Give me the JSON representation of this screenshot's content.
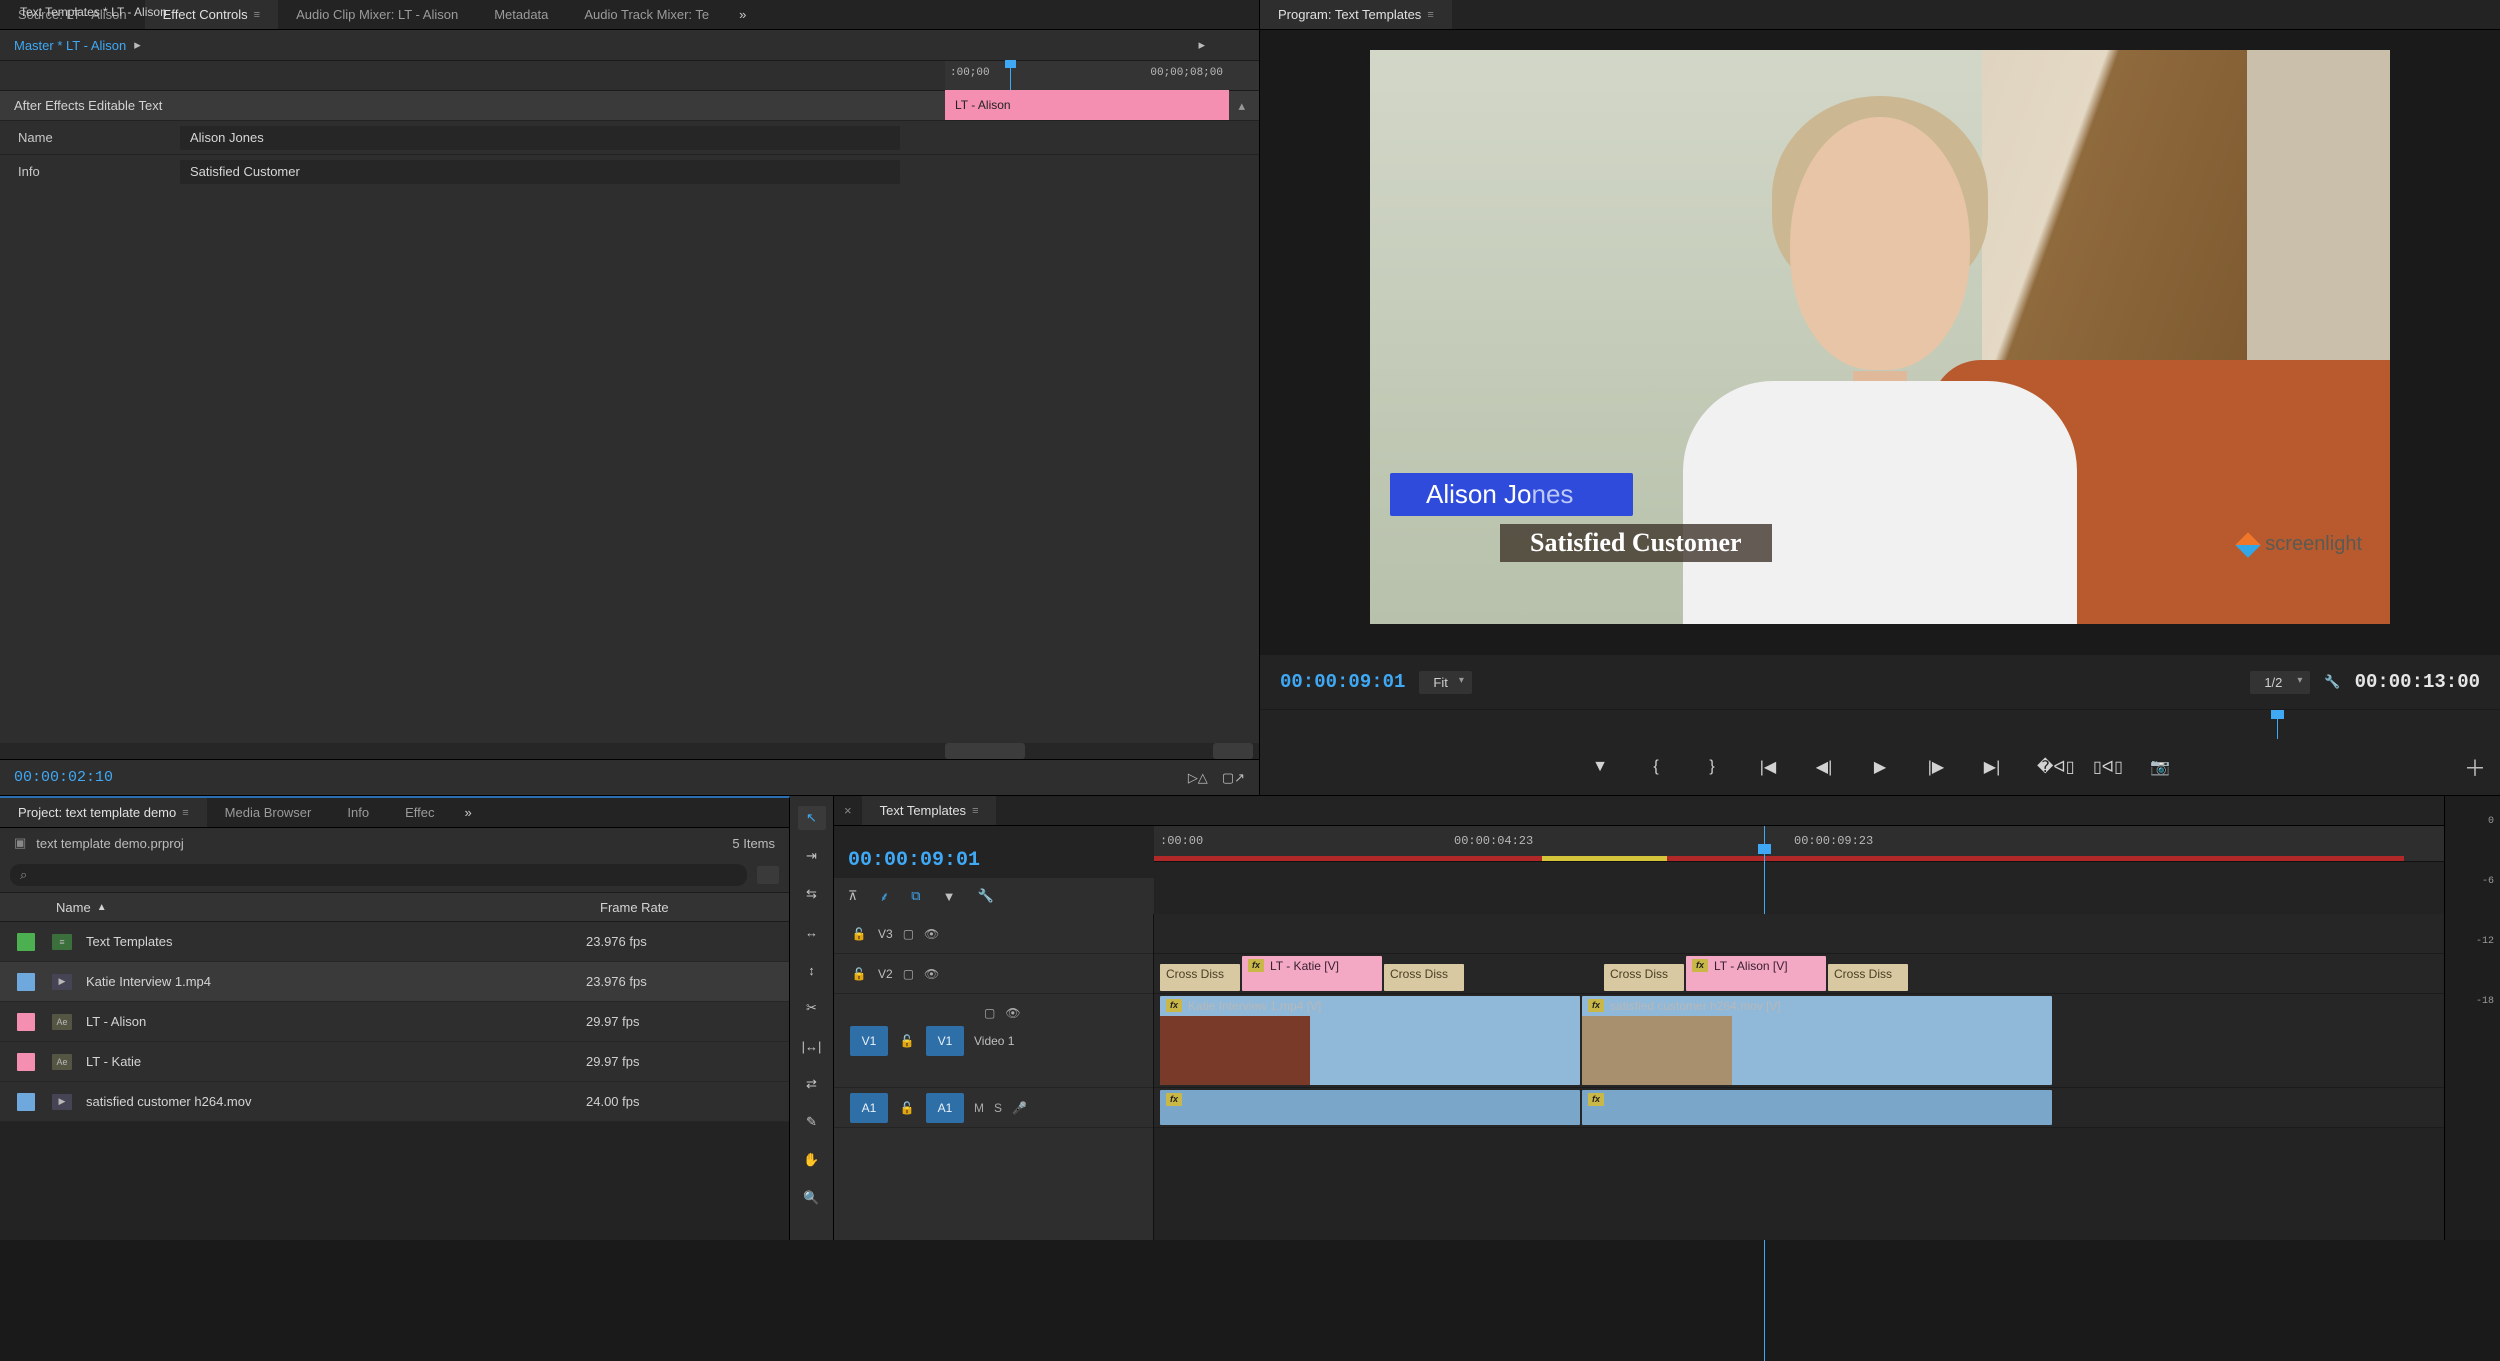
{
  "topLeftTabs": {
    "source": "Source: LT - Alison",
    "effectControls": "Effect Controls",
    "audioClipMixer": "Audio Clip Mixer: LT - Alison",
    "metadata": "Metadata",
    "audioTrackMixer": "Audio Track Mixer: Te"
  },
  "effectControls": {
    "master": "Master * LT - Alison",
    "clipPath": "Text Templates * LT - Alison",
    "tcStart": ":00;00",
    "tcEnd": "00;00;08;00",
    "section": "After Effects Editable Text",
    "clipBarLabel": "LT - Alison",
    "rows": {
      "nameLabel": "Name",
      "nameValue": "Alison Jones",
      "infoLabel": "Info",
      "infoValue": "Satisfied Customer"
    },
    "footerTc": "00:00:02:10"
  },
  "program": {
    "tabLabel": "Program: Text Templates",
    "lowerThirdName1": "Alison Jo",
    "lowerThirdName2": "nes",
    "lowerThirdSub": "Satisfied Customer",
    "watermark": "screenlight",
    "tcLeft": "00:00:09:01",
    "fit": "Fit",
    "res": "1/2",
    "tcRight": "00:00:13:00"
  },
  "project": {
    "tab": "Project: text template demo",
    "tabs": {
      "mediaBrowser": "Media Browser",
      "info": "Info",
      "effec": "Effec"
    },
    "file": "text template demo.prproj",
    "count": "5 Items",
    "cols": {
      "name": "Name",
      "frameRate": "Frame Rate"
    },
    "items": [
      {
        "chip": "green",
        "name": "Text Templates",
        "fr": "23.976 fps"
      },
      {
        "chip": "blue",
        "name": "Katie Interview 1.mp4",
        "fr": "23.976 fps"
      },
      {
        "chip": "pink",
        "name": "LT - Alison",
        "fr": "29.97 fps"
      },
      {
        "chip": "pink",
        "name": "LT - Katie",
        "fr": "29.97 fps"
      },
      {
        "chip": "blue",
        "name": "satisfied customer h264.mov",
        "fr": "24.00 fps"
      }
    ]
  },
  "timeline": {
    "tab": "Text Templates",
    "tc": "00:00:09:01",
    "rulerLabels": [
      ":00:00",
      "00:00:04:23",
      "00:00:09:23"
    ],
    "tracks": {
      "v3": "V3",
      "v2": "V2",
      "v1": "V1",
      "video1": "Video 1",
      "a1": "A1"
    },
    "clips": {
      "ltKatie": "LT - Katie [V]",
      "ltAlison": "LT - Alison [V]",
      "crossDiss": "Cross Diss",
      "katieInterview": "Katie Interview 1.mp4 [V]",
      "satisfied": "satisfied customer h264.mov [V]"
    },
    "audioIcons": {
      "m": "M",
      "s": "S"
    }
  },
  "meterMarks": [
    "0",
    "-6",
    "-12",
    "-18"
  ]
}
